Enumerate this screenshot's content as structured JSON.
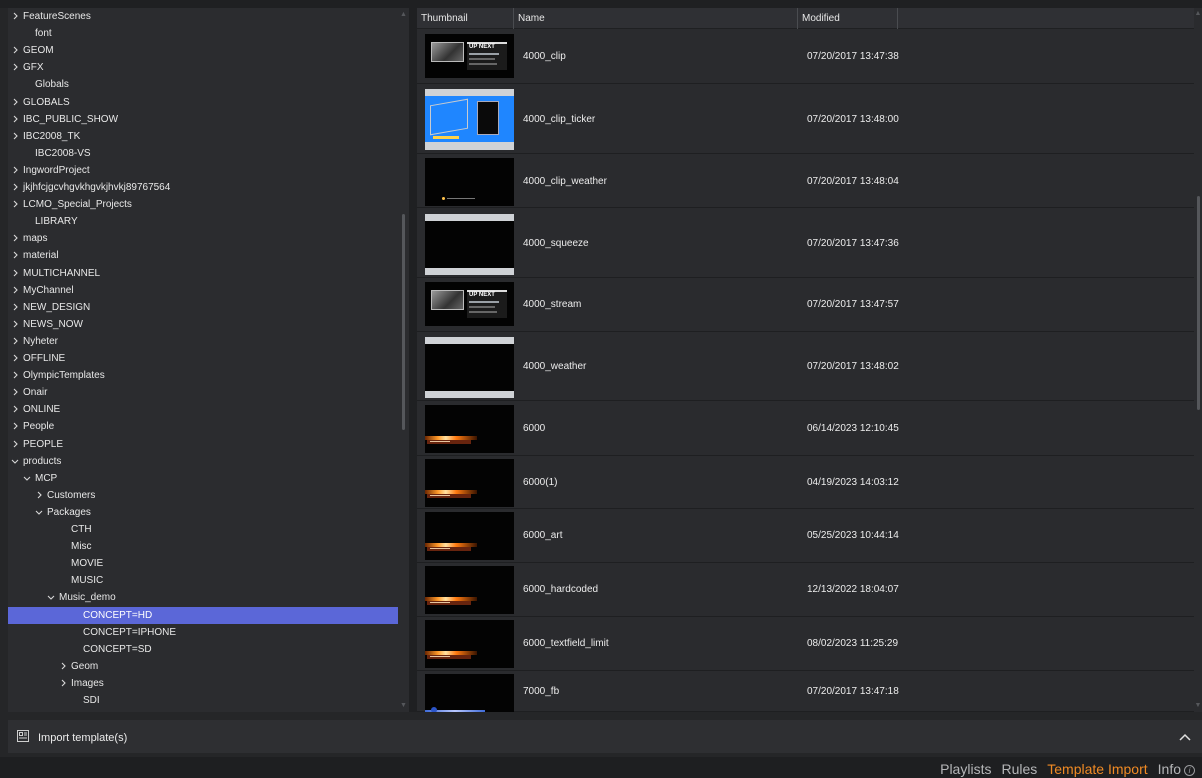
{
  "tree": {
    "items": [
      {
        "label": "FeatureScenes",
        "indent": 0,
        "toggle": "collapsed"
      },
      {
        "label": "font",
        "indent": 0,
        "toggle": "none"
      },
      {
        "label": "GEOM",
        "indent": 0,
        "toggle": "collapsed"
      },
      {
        "label": "GFX",
        "indent": 0,
        "toggle": "collapsed"
      },
      {
        "label": "Globals",
        "indent": 0,
        "toggle": "none"
      },
      {
        "label": "GLOBALS",
        "indent": 0,
        "toggle": "collapsed"
      },
      {
        "label": "IBC_PUBLIC_SHOW",
        "indent": 0,
        "toggle": "collapsed"
      },
      {
        "label": "IBC2008_TK",
        "indent": 0,
        "toggle": "collapsed"
      },
      {
        "label": "IBC2008-VS",
        "indent": 0,
        "toggle": "none"
      },
      {
        "label": "IngwordProject",
        "indent": 0,
        "toggle": "collapsed"
      },
      {
        "label": "jkjhfcjgcvhgvkhgvkjhvkj89767564",
        "indent": 0,
        "toggle": "collapsed"
      },
      {
        "label": "LCMO_Special_Projects",
        "indent": 0,
        "toggle": "collapsed"
      },
      {
        "label": "LIBRARY",
        "indent": 0,
        "toggle": "none"
      },
      {
        "label": "maps",
        "indent": 0,
        "toggle": "collapsed"
      },
      {
        "label": "material",
        "indent": 0,
        "toggle": "collapsed"
      },
      {
        "label": "MULTICHANNEL",
        "indent": 0,
        "toggle": "collapsed"
      },
      {
        "label": "MyChannel",
        "indent": 0,
        "toggle": "collapsed"
      },
      {
        "label": "NEW_DESIGN",
        "indent": 0,
        "toggle": "collapsed"
      },
      {
        "label": "NEWS_NOW",
        "indent": 0,
        "toggle": "collapsed"
      },
      {
        "label": "Nyheter",
        "indent": 0,
        "toggle": "collapsed"
      },
      {
        "label": "OFFLINE",
        "indent": 0,
        "toggle": "collapsed"
      },
      {
        "label": "OlympicTemplates",
        "indent": 0,
        "toggle": "collapsed"
      },
      {
        "label": "Onair",
        "indent": 0,
        "toggle": "collapsed"
      },
      {
        "label": "ONLINE",
        "indent": 0,
        "toggle": "collapsed"
      },
      {
        "label": "People",
        "indent": 0,
        "toggle": "collapsed"
      },
      {
        "label": "PEOPLE",
        "indent": 0,
        "toggle": "collapsed"
      },
      {
        "label": "products",
        "indent": 0,
        "toggle": "expanded"
      },
      {
        "label": "MCP",
        "indent": 1,
        "toggle": "expanded"
      },
      {
        "label": "Customers",
        "indent": 2,
        "toggle": "collapsed"
      },
      {
        "label": "Packages",
        "indent": 2,
        "toggle": "expanded"
      },
      {
        "label": "CTH",
        "indent": 3,
        "toggle": "none"
      },
      {
        "label": "Misc",
        "indent": 3,
        "toggle": "none"
      },
      {
        "label": "MOVIE",
        "indent": 3,
        "toggle": "none"
      },
      {
        "label": "MUSIC",
        "indent": 3,
        "toggle": "none"
      },
      {
        "label": "Music_demo",
        "indent": 3,
        "toggle": "expanded"
      },
      {
        "label": "CONCEPT=HD",
        "indent": 4,
        "toggle": "none",
        "selected": true
      },
      {
        "label": "CONCEPT=IPHONE",
        "indent": 4,
        "toggle": "none"
      },
      {
        "label": "CONCEPT=SD",
        "indent": 4,
        "toggle": "none"
      },
      {
        "label": "Geom",
        "indent": 4,
        "toggle": "collapsed"
      },
      {
        "label": "Images",
        "indent": 4,
        "toggle": "collapsed"
      },
      {
        "label": "SDI",
        "indent": 4,
        "toggle": "none"
      }
    ]
  },
  "table": {
    "columns": [
      "Thumbnail",
      "Name",
      "Modified"
    ],
    "rows": [
      {
        "name": "4000_clip",
        "modified": "07/20/2017 13:47:38",
        "thumbnail": "next-card"
      },
      {
        "name": "4000_clip_ticker",
        "modified": "07/20/2017 13:48:00",
        "thumbnail": "blue-panels"
      },
      {
        "name": "4000_clip_weather",
        "modified": "07/20/2017 13:48:04",
        "thumbnail": "black-small-text"
      },
      {
        "name": "4000_squeeze",
        "modified": "07/20/2017 13:47:36",
        "thumbnail": "black-letterbox"
      },
      {
        "name": "4000_stream",
        "modified": "07/20/2017 13:47:57",
        "thumbnail": "next-card"
      },
      {
        "name": "4000_weather",
        "modified": "07/20/2017 13:48:02",
        "thumbnail": "black-letterbox"
      },
      {
        "name": "6000",
        "modified": "06/14/2023 12:10:45",
        "thumbnail": "fire-lowerthird"
      },
      {
        "name": "6000(1)",
        "modified": "04/19/2023 14:03:12",
        "thumbnail": "fire-lowerthird"
      },
      {
        "name": "6000_art",
        "modified": "05/25/2023 10:44:14",
        "thumbnail": "fire-lowerthird"
      },
      {
        "name": "6000_hardcoded",
        "modified": "12/13/2022 18:04:07",
        "thumbnail": "fire-lowerthird"
      },
      {
        "name": "6000_textfield_limit",
        "modified": "08/02/2023 11:25:29",
        "thumbnail": "fire-lowerthird"
      },
      {
        "name": "7000_fb",
        "modified": "07/20/2017 13:47:18",
        "thumbnail": "blue-lowerthird"
      }
    ]
  },
  "thumbnail_text": {
    "next_card": "UP NEXT"
  },
  "import_bar": {
    "label": "Import template(s)",
    "icon": "import-template-icon"
  },
  "tabs": [
    {
      "label": "Playlists",
      "active": false
    },
    {
      "label": "Rules",
      "active": false
    },
    {
      "label": "Template Import",
      "active": true
    },
    {
      "label": "Info",
      "active": false
    }
  ],
  "colors": {
    "accent_active_tab": "#f08a24",
    "selection": "#5b67d8",
    "background": "#252628"
  }
}
